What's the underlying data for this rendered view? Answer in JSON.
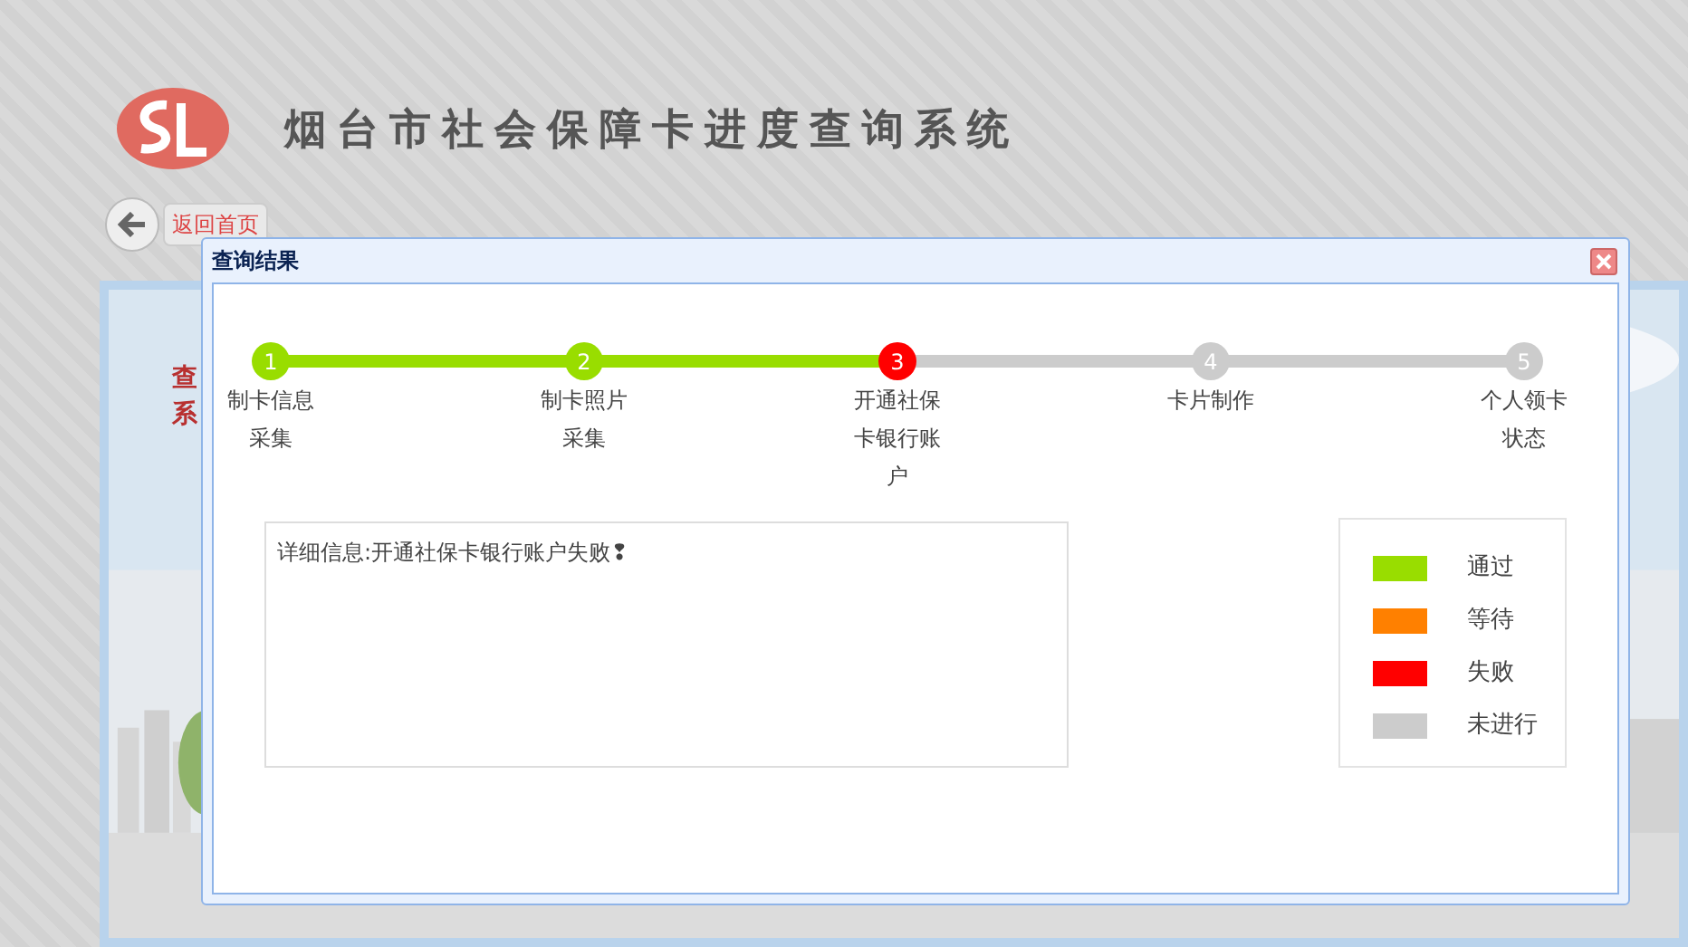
{
  "header": {
    "title": "烟台市社会保障卡进度查询系统"
  },
  "back_button": {
    "label": "返回首页"
  },
  "panel": {
    "side_text": [
      "查",
      "系"
    ]
  },
  "dialog": {
    "title": "查询结果",
    "steps": [
      {
        "number": "1",
        "label": "制卡信息采集",
        "color": "#99dd00"
      },
      {
        "number": "2",
        "label": "制卡照片采集",
        "color": "#99dd00"
      },
      {
        "number": "3",
        "label": "开通社保卡银行账户",
        "color": "#ff0000"
      },
      {
        "number": "4",
        "label": "卡片制作",
        "color": "#cccccc"
      },
      {
        "number": "5",
        "label": "个人领卡状态",
        "color": "#cccccc"
      }
    ],
    "connectors": [
      {
        "color": "#99dd00"
      },
      {
        "color": "#99dd00"
      },
      {
        "color": "#cccccc"
      },
      {
        "color": "#cccccc"
      }
    ],
    "detail": "详细信息:开通社保卡银行账户失败❢",
    "legend": [
      {
        "label": "通过",
        "color": "#99dd00"
      },
      {
        "label": "等待",
        "color": "#ff8000"
      },
      {
        "label": "失败",
        "color": "#ff0000"
      },
      {
        "label": "未进行",
        "color": "#cccccc"
      }
    ]
  }
}
